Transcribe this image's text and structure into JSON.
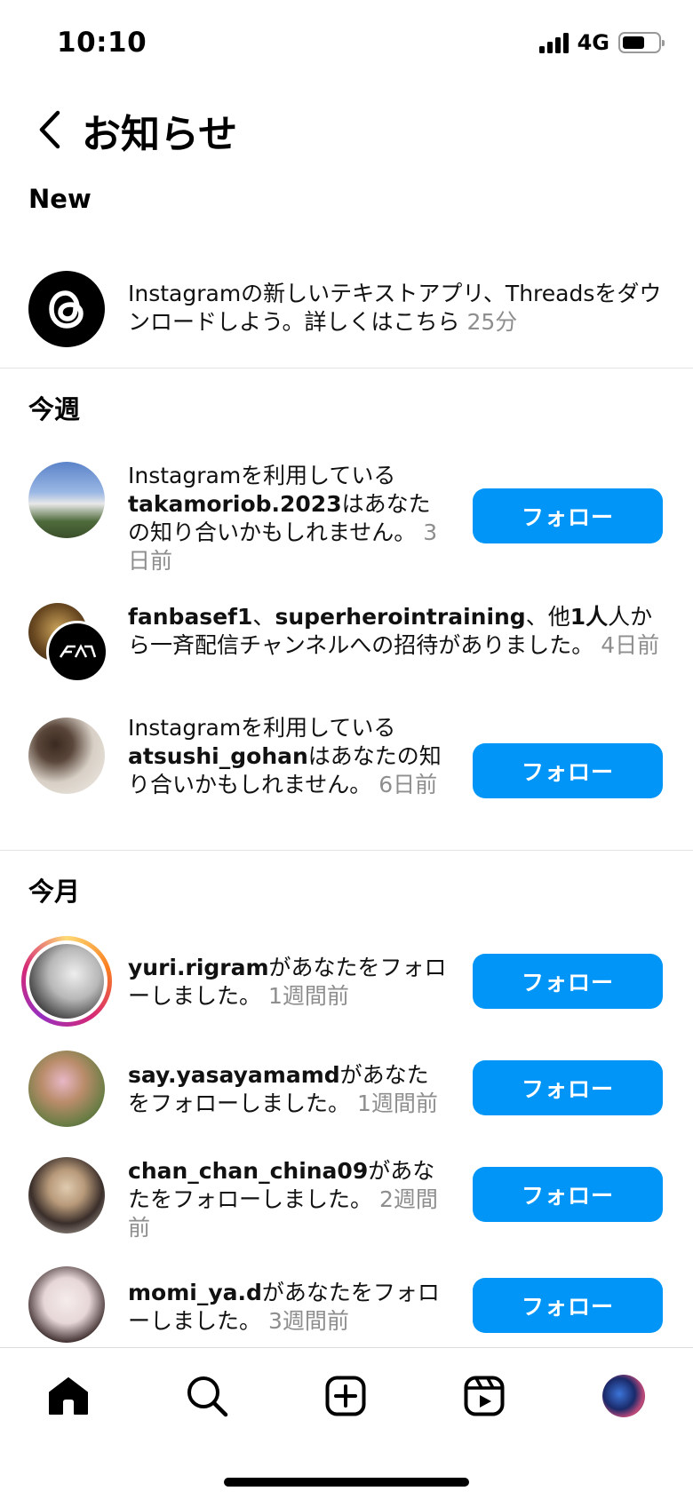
{
  "status_bar": {
    "time": "10:10",
    "network": "4G"
  },
  "header": {
    "title": "お知らせ",
    "back_icon": "chevron-left-icon"
  },
  "sections": {
    "new": "New",
    "this_week": "今週",
    "this_month": "今月"
  },
  "notifications": {
    "threads": {
      "text": "Instagramの新しいテキストアプリ、Threadsをダウンロードしよう。詳しくはこちら",
      "time": "25分"
    },
    "takamori": {
      "prefix": "Instagramを利用している",
      "user": "takamoriob.2023",
      "suffix": "はあなたの知り合いかもしれません。",
      "time": "3日前",
      "button": "フォロー"
    },
    "channel": {
      "user1": "fanbasef1",
      "sep": "、",
      "user2": "superherointraining",
      "sep2": "、他",
      "others": "他1人",
      "suffix": "人から一斉配信チャンネルへの招待がありました。",
      "time": "4日前"
    },
    "atsushi": {
      "prefix": "Instagramを利用している",
      "user": "atsushi_gohan",
      "suffix": "はあなたの知り合いかもしれません。",
      "time": "6日前",
      "button": "フォロー"
    },
    "yuri": {
      "user": "yuri.rigram",
      "suffix": "があなたをフォローしました。",
      "time": "1週間前",
      "button": "フォロー"
    },
    "say": {
      "user": "say.yasayamamd",
      "suffix": "があなたをフォローしました。",
      "time": "1週間前",
      "button": "フォロー"
    },
    "chan": {
      "user": "chan_chan_china09",
      "suffix": "があなたをフォローしました。",
      "time": "2週間前",
      "button": "フォロー"
    },
    "momi": {
      "user": "momi_ya.d",
      "suffix": "があなたをフォローしました。",
      "time": "3週間前",
      "button": "フォロー"
    }
  },
  "bottom_nav": {
    "items": [
      "home-icon",
      "search-icon",
      "create-icon",
      "reels-icon",
      "profile-avatar"
    ]
  },
  "colors": {
    "follow_button": "#0095f6",
    "timestamp": "#8e8e8e",
    "story_ring": [
      "#feda75",
      "#fa7e1e",
      "#d62976",
      "#962fbf"
    ]
  }
}
